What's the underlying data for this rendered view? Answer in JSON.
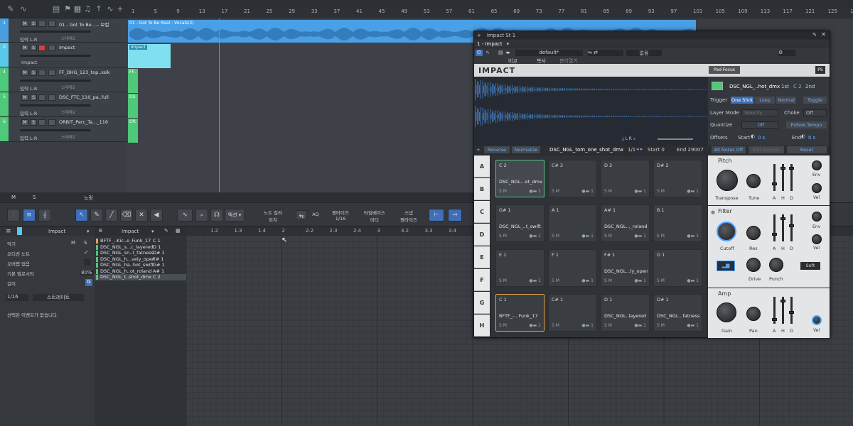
{
  "ruler": {
    "marks": [
      "1",
      "5",
      "9",
      "13",
      "17",
      "21",
      "25",
      "29",
      "33",
      "37",
      "41",
      "45",
      "49",
      "53",
      "57",
      "61",
      "65",
      "69",
      "73",
      "77",
      "81",
      "85",
      "89",
      "93",
      "97",
      "101",
      "105",
      "109",
      "113",
      "117",
      "121",
      "125",
      "129"
    ]
  },
  "tracks": [
    {
      "num": "1",
      "name": "01 - Got To Be ...- 보컬",
      "input": "입력 L-R",
      "mon": "스테레오",
      "color": "#4a9fe0"
    },
    {
      "num": "2",
      "name": "Impact",
      "input": "Impact",
      "mon": "",
      "color": "#5ac8e8"
    },
    {
      "num": "4",
      "name": "FF_DHG_123_top..ssik",
      "input": "입력 L-R",
      "mon": "스테레오",
      "color": "#4ec879"
    },
    {
      "num": "5",
      "name": "DSC_FTC_110_pa..full",
      "input": "입력 L-R",
      "mon": "스테레오",
      "color": "#4ec879"
    },
    {
      "num": "6",
      "name": "ORBIT_Perc_Ta..._116",
      "input": "입력 L-R",
      "mon": "스테레오",
      "color": "#4ec879"
    }
  ],
  "clips": {
    "vocal": "01 - Got To Be Real - Vocals(2)",
    "impact": "Impact",
    "c4": "FF..",
    "c5": "DS",
    "c6": "OR"
  },
  "arrbar": {
    "m": "M",
    "s": "S",
    "label": "노랑"
  },
  "editor_toolbar": {
    "action": "액션",
    "note_color_lbl": "노트 컬러",
    "note_color_val": "피치",
    "quantize_lbl": "퀀타이즈",
    "quantize_val": "1/16",
    "timebase_lbl": "타임베이스",
    "timebase_val": "마디",
    "snap_lbl": "스냅",
    "snap_val": "퀀타이즈",
    "aq": "AQ"
  },
  "editor_left": {
    "track_name": "Impact",
    "instrument_name": "Impact",
    "rows": [
      {
        "label": "악기",
        "m": "M",
        "s": "S"
      },
      {
        "label": "오디션 노트"
      },
      {
        "label": "오버랩 없음"
      },
      {
        "label": "기본 벨로시티",
        "value": "80%"
      },
      {
        "label": "길이"
      }
    ],
    "length_val": "1/16",
    "length_mode": "스트레이트",
    "empty_msg": "선택된 이벤트가 없습니다."
  },
  "editor_ruler": [
    "1.2",
    "1.3",
    "1.4",
    "2",
    "2.2",
    "2.3",
    "2.4",
    "3",
    "3.2",
    "3.3",
    "3.4"
  ],
  "note_list": [
    {
      "name": "BFTF_..Kic..e_Funk_17",
      "note": "C 1",
      "color": "#e0a84a"
    },
    {
      "name": "DSC_NGL_s...c_layered",
      "note": "D 1",
      "color": "#4ec879"
    },
    {
      "name": "DSC_NGL_sn..t_fatness",
      "note": "D# 1",
      "color": "#4ec879"
    },
    {
      "name": "DSC_NGL_h...vely_open",
      "note": "F# 1",
      "color": "#4ec879"
    },
    {
      "name": "DSC_NGL_ha..hot_swift",
      "note": "G# 1",
      "color": "#4ec879"
    },
    {
      "name": "DSC_NGL_h..ot_roland",
      "note": "A# 1",
      "color": "#4ec879"
    },
    {
      "name": "DSC_NGL_t..shot_dmx",
      "note": "C 2",
      "color": "#4ec879"
    }
  ],
  "impact": {
    "window_title": "Impact St 1",
    "instance": "1 - Impact",
    "preset": "default*",
    "compare": "비교",
    "copy": "복사",
    "extend": "분리열기",
    "none": "없음",
    "logo": "IMPACT",
    "pad_focus": "Pad Focus",
    "sample_name": "DSC_NGL_..hot_dmx",
    "range_lo": "1st",
    "range_note": "C 2",
    "range_hi": "2nd",
    "trigger_lbl": "Trigger",
    "trigger_opts": [
      "One Shot",
      "Loop",
      "Normal"
    ],
    "toggle": "Toggle",
    "layer_mode_lbl": "Layer Mode",
    "layer_mode_val": "Velocity",
    "choke_lbl": "Choke",
    "choke_val": "Off",
    "quantize_lbl": "Quantize",
    "quantize_val": "Off",
    "follow_tempo": "Follow Tempo",
    "offsets_lbl": "Offsets",
    "start_lbl": "Start",
    "start_val": "0 s",
    "end_lbl": "End",
    "end_val": "0 s",
    "reverse": "Reverse",
    "normalize": "Normalize",
    "file": "DSC_NGL_tom_one_shot_dmx",
    "layer": "1/1",
    "start": "Start 0",
    "end": "End 29007",
    "all_notes_off": "All Notes Off",
    "edit_sample": "Edit Sample",
    "reset": "Reset",
    "banks": [
      "A",
      "B",
      "C",
      "D",
      "E",
      "F",
      "G",
      "H"
    ],
    "pads": [
      {
        "n": "C 2",
        "s": "DSC_NGL...ot_dmx",
        "sel": true
      },
      {
        "n": "C# 2",
        "s": ""
      },
      {
        "n": "D 2",
        "s": ""
      },
      {
        "n": "D# 2",
        "s": ""
      },
      {
        "n": "G# 1",
        "s": "DSC_NGL_..t_swift"
      },
      {
        "n": "A 1",
        "s": ""
      },
      {
        "n": "A# 1",
        "s": "DSC_NGL..._roland"
      },
      {
        "n": "B 1",
        "s": ""
      },
      {
        "n": "E 1",
        "s": ""
      },
      {
        "n": "F 1",
        "s": ""
      },
      {
        "n": "F# 1",
        "s": "DSC_NGL...ly_open"
      },
      {
        "n": "G 1",
        "s": ""
      },
      {
        "n": "C 1",
        "s": "BFTF_-...Funk_17",
        "orange": true
      },
      {
        "n": "C# 1",
        "s": ""
      },
      {
        "n": "D 1",
        "s": "DSC_NGL..layered"
      },
      {
        "n": "D# 1",
        "s": "DSC_NGL...fatness"
      }
    ],
    "pitch": {
      "title": "Pitch",
      "transpose": "Transpose",
      "tune": "Tune",
      "env": "Env",
      "vel": "Vel"
    },
    "filter": {
      "title": "Filter",
      "cutoff": "Cutoff",
      "res": "Res",
      "env": "Env",
      "vel": "Vel",
      "drive": "Drive",
      "punch": "Punch",
      "soft": "Soft"
    },
    "amp": {
      "title": "Amp",
      "gain": "Gain",
      "pan": "Pan",
      "vel": "Vel"
    },
    "adsr": [
      "A",
      "H",
      "D"
    ]
  }
}
